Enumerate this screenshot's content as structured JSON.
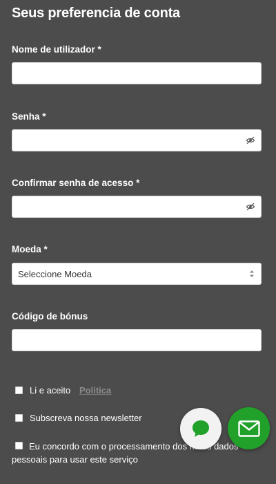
{
  "form": {
    "title": "Seus preferencia de conta",
    "username": {
      "label": "Nome de utilizador *",
      "value": ""
    },
    "password": {
      "label": "Senha *",
      "value": ""
    },
    "confirm_password": {
      "label": "Confirmar senha de acesso *",
      "value": ""
    },
    "currency": {
      "label": "Moeda *",
      "selected": "Seleccione Moeda"
    },
    "bonus_code": {
      "label": "Código de bónus",
      "value": ""
    }
  },
  "consents": {
    "policy": {
      "text": "Li e aceito",
      "link": "Politica",
      "checked": false
    },
    "newsletter": {
      "text": "Subscreva nossa newsletter",
      "checked": false
    },
    "data_processing": {
      "text": "Eu concordo com o processamento dos meus dados pessoais para usar este serviço",
      "checked": false
    }
  },
  "floating_actions": {
    "chat_icon": "chat-bubble-icon",
    "mail_icon": "envelope-icon",
    "chat_bg": "#f2f2f2",
    "mail_bg": "#21a02a",
    "icon_green": "#21a02a"
  },
  "colors": {
    "background": "#4c4c4c",
    "text": "#ffffff",
    "link": "#8c8c8c"
  }
}
